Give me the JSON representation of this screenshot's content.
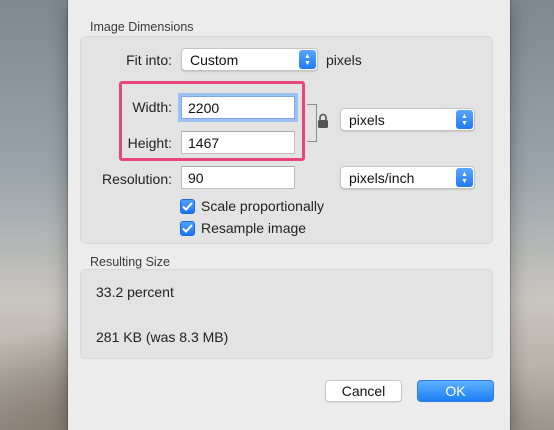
{
  "image_dimensions": {
    "section_title": "Image Dimensions",
    "fit_into": {
      "label": "Fit into:",
      "value": "Custom",
      "unit": "pixels"
    },
    "width": {
      "label": "Width:",
      "value": "2200"
    },
    "height": {
      "label": "Height:",
      "value": "1467"
    },
    "size_unit": {
      "value": "pixels"
    },
    "resolution": {
      "label": "Resolution:",
      "value": "90",
      "unit": "pixels/inch"
    },
    "scale_proportionally": {
      "label": "Scale proportionally",
      "checked": true
    },
    "resample_image": {
      "label": "Resample image",
      "checked": true
    }
  },
  "resulting_size": {
    "section_title": "Resulting Size",
    "percent": "33.2 percent",
    "file_size": "281 KB (was 8.3 MB)"
  },
  "buttons": {
    "cancel": "Cancel",
    "ok": "OK"
  },
  "colors": {
    "highlight": "#e6447a",
    "accent": "#1f7af2",
    "focus_ring": "#9cc1f3"
  }
}
